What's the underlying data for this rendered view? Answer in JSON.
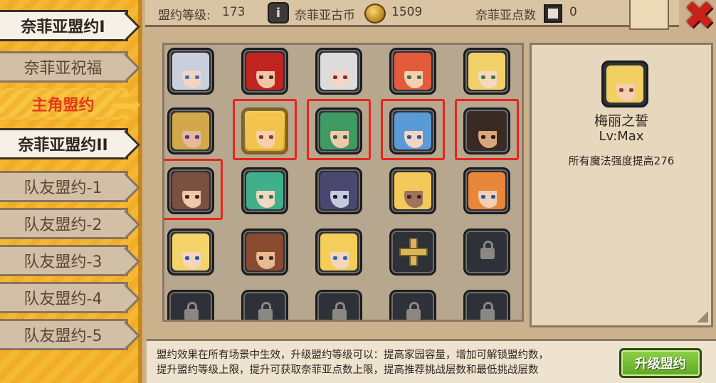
{
  "sidebar": {
    "tabs": [
      {
        "label": "奈菲亚盟约I",
        "style": "white"
      },
      {
        "label": "奈菲亚祝福",
        "style": "normal"
      },
      {
        "label": "主角盟约",
        "style": "active"
      },
      {
        "label": "奈菲亚盟约II",
        "style": "white"
      },
      {
        "label": "队友盟约-1",
        "style": "normal"
      },
      {
        "label": "队友盟约-2",
        "style": "normal"
      },
      {
        "label": "队友盟约-3",
        "style": "normal"
      },
      {
        "label": "队友盟约-4",
        "style": "normal"
      },
      {
        "label": "队友盟约-5",
        "style": "normal"
      }
    ]
  },
  "topbar": {
    "level_label": "盟约等级:",
    "level_value": "173",
    "info_icon": "i",
    "coin_label": "奈菲亚古币",
    "coin_value": "1509",
    "points_label": "奈菲亚点数",
    "points_value": "0",
    "close_icon": "✖"
  },
  "grid": {
    "cells": [
      {
        "kind": "hero",
        "hair": "#c9d0dc",
        "skin": "#f4d6c0",
        "eye": "#3b6fd1"
      },
      {
        "kind": "hero",
        "hair": "#c2241f",
        "skin": "#f2c4a8",
        "eye": "#5a2a1e"
      },
      {
        "kind": "hero",
        "hair": "#dcdcdc",
        "skin": "#f1d7c8",
        "eye": "#8a2d2d"
      },
      {
        "kind": "hero",
        "hair": "#e25b3a",
        "skin": "#f4cfb1",
        "eye": "#2f7a3a"
      },
      {
        "kind": "hero",
        "hair": "#f1d06a",
        "skin": "#f4d9bd",
        "eye": "#3a7f3a"
      },
      {
        "kind": "hero",
        "hair": "#d2a94a",
        "skin": "#e6b89a",
        "eye": "#4a3a8a"
      },
      {
        "kind": "hero",
        "hair": "#f2c44d",
        "skin": "#f4cfb1",
        "eye": "#9a3a2a",
        "gold": true
      },
      {
        "kind": "hero",
        "hair": "#3f9a64",
        "skin": "#f0c9ad",
        "eye": "#2b6a3a"
      },
      {
        "kind": "hero",
        "hair": "#5a9ad6",
        "skin": "#f4d5c2",
        "eye": "#2b57a8"
      },
      {
        "kind": "hero",
        "hair": "#3a2a22",
        "skin": "#d9a67c",
        "eye": "#2a1a12"
      },
      {
        "kind": "hero",
        "hair": "#7a5040",
        "skin": "#f0c7a8",
        "eye": "#3b2a22"
      },
      {
        "kind": "hero",
        "hair": "#3fb08a",
        "skin": "#f4d5bd",
        "eye": "#2a7a5a"
      },
      {
        "kind": "hero",
        "hair": "#4a4870",
        "skin": "#c7c9df",
        "eye": "#1e1e30"
      },
      {
        "kind": "hero",
        "hair": "#f3c95a",
        "skin": "#a0745a",
        "eye": "#3a2a1a"
      },
      {
        "kind": "hero",
        "hair": "#e8863a",
        "skin": "#f4d0b2",
        "eye": "#2b57a8"
      },
      {
        "kind": "hero",
        "hair": "#f4d36a",
        "skin": "#f4d5bd",
        "eye": "#2b57a8"
      },
      {
        "kind": "hero",
        "hair": "#8a4a30",
        "skin": "#e9b992",
        "eye": "#3a2a1a"
      },
      {
        "kind": "hero",
        "hair": "#f4ce58",
        "skin": "#f4d5bd",
        "eye": "#2b6ab8"
      },
      {
        "kind": "plus"
      },
      {
        "kind": "lock"
      },
      {
        "kind": "lock"
      },
      {
        "kind": "lock"
      },
      {
        "kind": "lock"
      },
      {
        "kind": "lock"
      },
      {
        "kind": "lock"
      }
    ],
    "highlighted": [
      6,
      7,
      8,
      9,
      10
    ]
  },
  "detail": {
    "portrait": {
      "hair": "#f1cf62",
      "skin": "#f4cfb1",
      "eye": "#9a3a2a"
    },
    "name": "梅丽之誓",
    "level": "Lv:Max",
    "description": "所有魔法强度提高276"
  },
  "bottom": {
    "description_line1": "盟约效果在所有场景中生效，升级盟约等级可以：提高家园容量，增加可解锁盟约数，",
    "description_line2": "提升盟约等级上限，提升可获取奈菲亚点数上限，提高推荐挑战层数和最低挑战层数",
    "upgrade_label": "升级盟约"
  }
}
